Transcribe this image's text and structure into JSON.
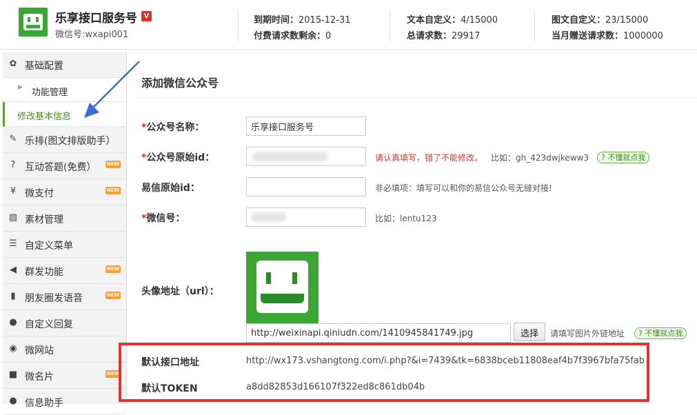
{
  "header": {
    "account_name": "乐享接口服务号",
    "verified_badge": "V",
    "wechat_id": "微信号:wxapi001",
    "stats": [
      {
        "label": "到期时间：",
        "value": "2015-12-31"
      },
      {
        "label": "付费请求数剩余：",
        "value": "0"
      },
      {
        "label": "文本自定义：",
        "value": "4/15000"
      },
      {
        "label": "总请求数：",
        "value": "29917"
      },
      {
        "label": "图文自定义：",
        "value": "23/15000"
      },
      {
        "label": "当月赠送请求数：",
        "value": "1000000"
      }
    ]
  },
  "sidebar": {
    "items": [
      {
        "label": "基础配置",
        "icon": "gear-icon",
        "glyph": "✿",
        "new": false
      },
      {
        "label": "功能管理",
        "sub": true
      },
      {
        "label": "修改基本信息",
        "sub": true,
        "active": true
      },
      {
        "label": "乐排(图文排版助手）",
        "icon": "pencil-icon",
        "glyph": "✎",
        "new": false
      },
      {
        "label": "互动答题(免费）",
        "icon": "question-icon",
        "glyph": "?",
        "new": true
      },
      {
        "label": "微支付",
        "icon": "money-icon",
        "glyph": "¥",
        "new": true
      },
      {
        "label": "素材管理",
        "icon": "picture-icon",
        "glyph": "▧",
        "new": false
      },
      {
        "label": "自定义菜单",
        "icon": "list-icon",
        "glyph": "☰",
        "new": false
      },
      {
        "label": "群发功能",
        "icon": "megaphone-icon",
        "glyph": "◀",
        "new": true
      },
      {
        "label": "朋友圈发语音",
        "icon": "bookmark-icon",
        "glyph": "▮",
        "new": true
      },
      {
        "label": "自定义回复",
        "icon": "comment-icon",
        "glyph": "●",
        "new": false
      },
      {
        "label": "微网站",
        "icon": "globe-icon",
        "glyph": "◉",
        "new": false
      },
      {
        "label": "微名片",
        "icon": "truck-icon",
        "glyph": "■",
        "new": true
      },
      {
        "label": "信息助手",
        "icon": "user-icon",
        "glyph": "●",
        "new": false
      }
    ],
    "new_label": "NEW"
  },
  "main": {
    "title": "添加微信公众号",
    "req_mark": "*",
    "fields": {
      "name_label": "公众号名称：",
      "name_value": "乐享接口服务号",
      "origid_label": "公众号原始id：",
      "origid_hint_red": "请认真填写，错了不能修改。",
      "origid_hint": "比如：gh_423dwjkeww3",
      "yixin_label": "易信原始id：",
      "yixin_hint": "非必填项：填写可以和你的易信公众号无缝对接!",
      "wechat_label": "微信号：",
      "wechat_hint": "比如：lentu123",
      "avatar_label": "头像地址（url）：",
      "avatar_url": "http://weixinapi.qiniudn.com/1410945841749.jpg",
      "choose_button": "选择",
      "avatar_hint": "请填写图片外链地址"
    },
    "help_link": "? 不懂就点我",
    "info": {
      "api_label": "默认接口地址",
      "api_value": "http://wx173.vshangtong.com/i.php?&i=7439&tk=6838bceb11808eaf4b7f3967bfa75fab",
      "token_label": "默认TOKEN",
      "token_value": "a8dd82853d166107f322ed8c861db04b"
    }
  },
  "colors": {
    "brand_green": "#3aa634",
    "alert_red": "#e8322f",
    "arrow_blue": "#3b6fd6"
  }
}
